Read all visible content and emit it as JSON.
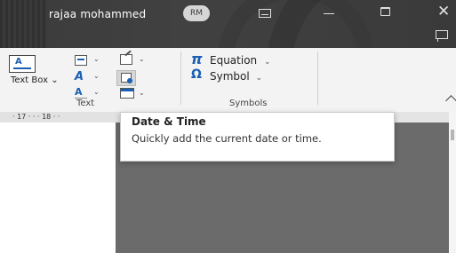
{
  "titlebar": {
    "user_name": "rajaa mohammed",
    "avatar_initials": "RM",
    "buttons": [
      "ribbon-display-options",
      "minimize",
      "restore",
      "close"
    ]
  },
  "ribbon": {
    "text_group": {
      "label": "Text",
      "text_box_label": "Text Box",
      "text_box_dropdown": "⌄"
    },
    "symbols_group": {
      "label": "Symbols",
      "equation_glyph": "π",
      "equation_label": "Equation",
      "equation_dropdown": "⌄",
      "symbol_glyph": "Ω",
      "symbol_label": "Symbol",
      "symbol_dropdown": "⌄"
    },
    "dropdown_glyph": "⌄"
  },
  "ruler": {
    "text": "· 17 · · · 18 · ·"
  },
  "tooltip": {
    "title": "Date & Time",
    "description": "Quickly add the current date or time."
  },
  "colors": {
    "titlebar_bg": "#3b3b3b",
    "ribbon_bg": "#f3f3f3",
    "accent": "#1a5fb4",
    "selected_button": "#d6d6d6"
  }
}
